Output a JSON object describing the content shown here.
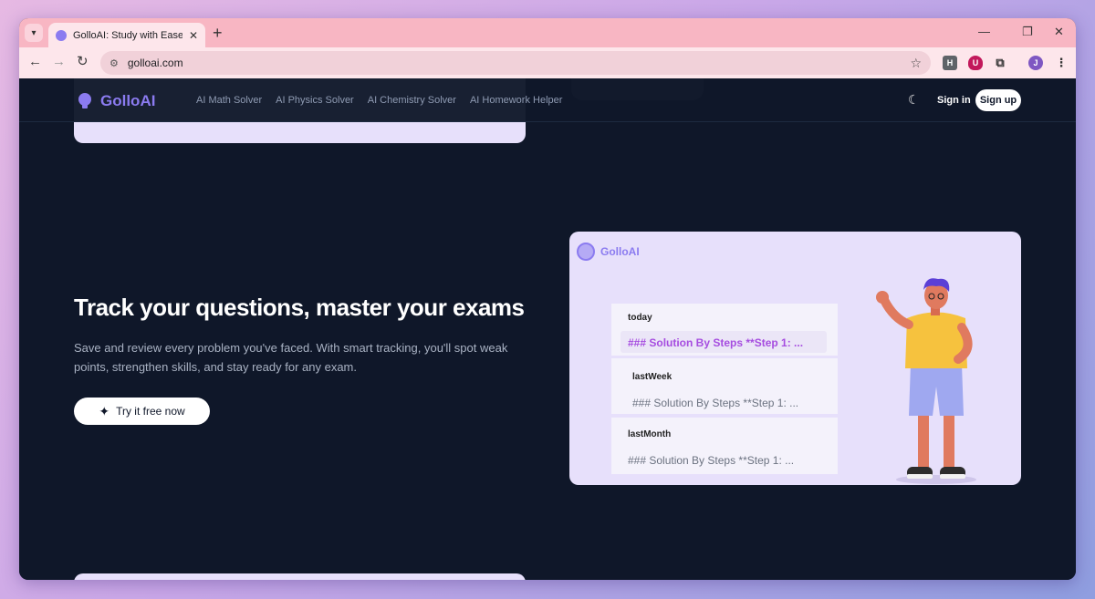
{
  "browser": {
    "tab_title": "GolloAI: Study with Ease. Go wit",
    "tab_close": "✕",
    "new_tab": "+",
    "url": "golloai.com",
    "ext_h": "H",
    "ext_u": "U",
    "profile_initial": "J"
  },
  "header": {
    "logo_text": "GolloAI",
    "nav": [
      "AI Math Solver",
      "AI Physics Solver",
      "AI Chemistry Solver",
      "AI Homework Helper"
    ],
    "sign_in": "Sign in",
    "sign_up": "Sign up"
  },
  "hero": {
    "title": "Track your questions, master your exams",
    "description": "Save and review every problem you've faced. With smart tracking, you'll spot weak points, strengthen skills, and stay ready for any exam.",
    "cta_label": "Try it free now"
  },
  "preview": {
    "logo_text": "GolloAI",
    "groups": [
      {
        "label": "today",
        "entry": "### Solution By Steps **Step 1: ..."
      },
      {
        "label": "lastWeek",
        "entry": "### Solution By Steps **Step 1: ..."
      },
      {
        "label": "lastMonth",
        "entry": "### Solution By Steps **Step 1: ..."
      }
    ]
  },
  "colors": {
    "accent": "#8b7bf0",
    "page_bg": "#0f1729",
    "card_bg": "#e7e0fb",
    "active_entry": "#a64de0"
  }
}
